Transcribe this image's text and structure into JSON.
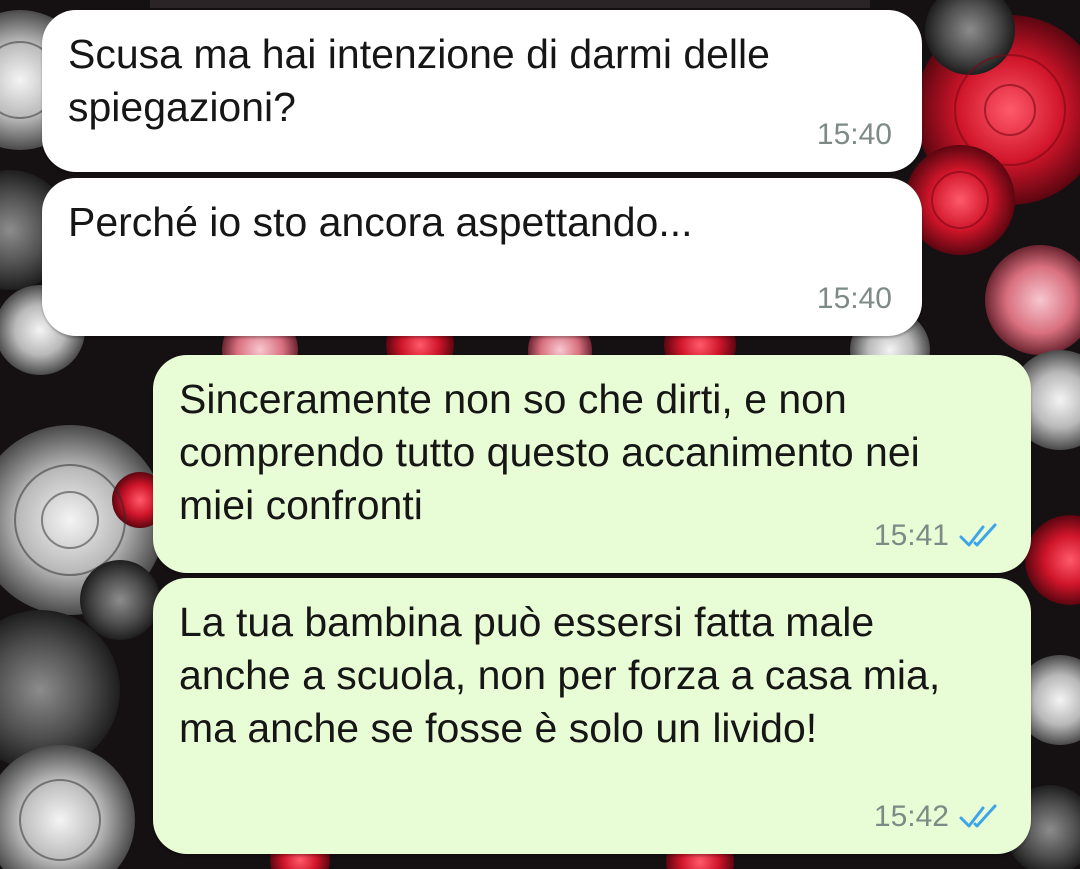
{
  "chat": {
    "messages": [
      {
        "direction": "incoming",
        "text": "Scusa ma hai intenzione di darmi delle spiegazioni?",
        "time": "15:40"
      },
      {
        "direction": "incoming",
        "text": "Perché io sto ancora aspettando...",
        "time": "15:40"
      },
      {
        "direction": "outgoing",
        "text": "Sinceramente non so che dirti, e non comprendo tutto questo accanimento nei miei confronti",
        "time": "15:41",
        "status_icon": "double-check-icon",
        "status": "read"
      },
      {
        "direction": "outgoing",
        "text": "La tua bambina può essersi fatta male anche a scuola, non per forza a casa mia, ma anche se fosse è solo un livido!",
        "time": "15:42",
        "status_icon": "double-check-icon",
        "status": "read"
      }
    ]
  },
  "theme": {
    "incoming_bubble": "#ffffff",
    "outgoing_bubble": "#e8fcd5",
    "time_color": "#7e8a86",
    "read_tick_color": "#3ea6e8",
    "wallpaper": "roses-red-and-grey"
  }
}
